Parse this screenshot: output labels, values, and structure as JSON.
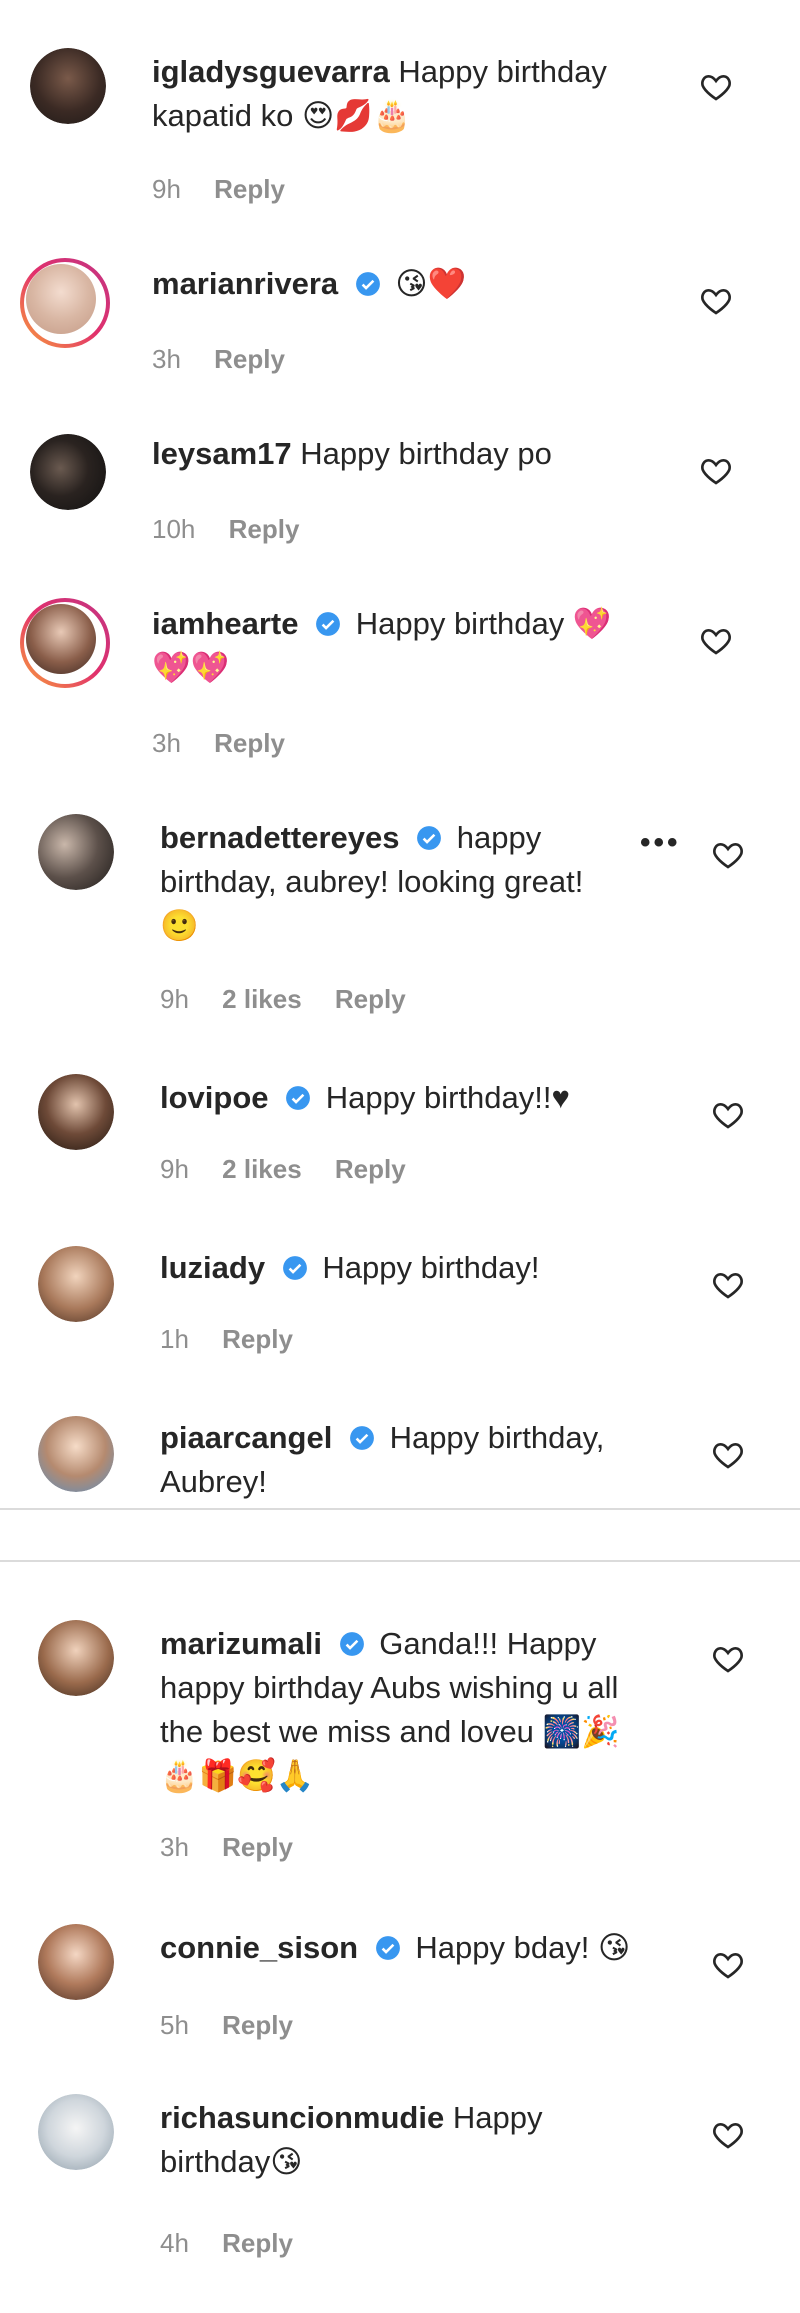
{
  "comments": [
    {
      "username": "igladysguevarra",
      "verified": false,
      "text": "Happy birthday",
      "text2": "kapatid ko",
      "emoji2": "😍💋🎂",
      "time": "9h",
      "likes": "",
      "reply": "Reply"
    },
    {
      "username": "marianrivera",
      "verified": true,
      "text": "",
      "emoji": "😘❤️",
      "time": "3h",
      "likes": "",
      "reply": "Reply"
    },
    {
      "username": "leysam17",
      "verified": false,
      "text": "Happy birthday po",
      "time": "10h",
      "likes": "",
      "reply": "Reply"
    },
    {
      "username": "iamhearte",
      "verified": true,
      "text": "Happy birthday",
      "emoji": "💖",
      "emoji2": "💖💖",
      "time": "3h",
      "likes": "",
      "reply": "Reply"
    },
    {
      "username": "bernadettereyes",
      "verified": true,
      "text": "happy",
      "text2": "birthday, aubrey! looking great!",
      "emoji3": "🙂",
      "time": "9h",
      "likes": "2 likes",
      "reply": "Reply",
      "more": "•••"
    },
    {
      "username": "lovipoe",
      "verified": true,
      "text": "Happy birthday!!♥",
      "time": "9h",
      "likes": "2 likes",
      "reply": "Reply"
    },
    {
      "username": "luziady",
      "verified": true,
      "text": "Happy birthday!",
      "time": "1h",
      "likes": "",
      "reply": "Reply"
    },
    {
      "username": "piaarcangel",
      "verified": true,
      "text": "Happy birthday,",
      "text2": "Aubrey!",
      "time": "",
      "likes": "",
      "reply": ""
    },
    {
      "username": "marizumali",
      "verified": true,
      "text": "Ganda!!! Happy",
      "text2": "happy birthday Aubs wishing u all",
      "text3": "the best we miss and loveu",
      "emoji3": "🎆🎉",
      "emoji4": "🎂🎁🥰🙏",
      "time": "3h",
      "likes": "",
      "reply": "Reply"
    },
    {
      "username": "connie_sison",
      "verified": true,
      "text": "Happy bday!",
      "emoji": "😘",
      "time": "5h",
      "likes": "",
      "reply": "Reply"
    },
    {
      "username": "richasuncionmudie",
      "verified": false,
      "text": "Happy",
      "text2": "birthday",
      "emoji2": "😘",
      "time": "4h",
      "likes": "",
      "reply": "Reply"
    }
  ],
  "colors": {
    "verified": "#3897f0",
    "meta": "#8e8e8e",
    "text": "#262626",
    "ring_start": "#f9a13b",
    "ring_end": "#c13584"
  }
}
